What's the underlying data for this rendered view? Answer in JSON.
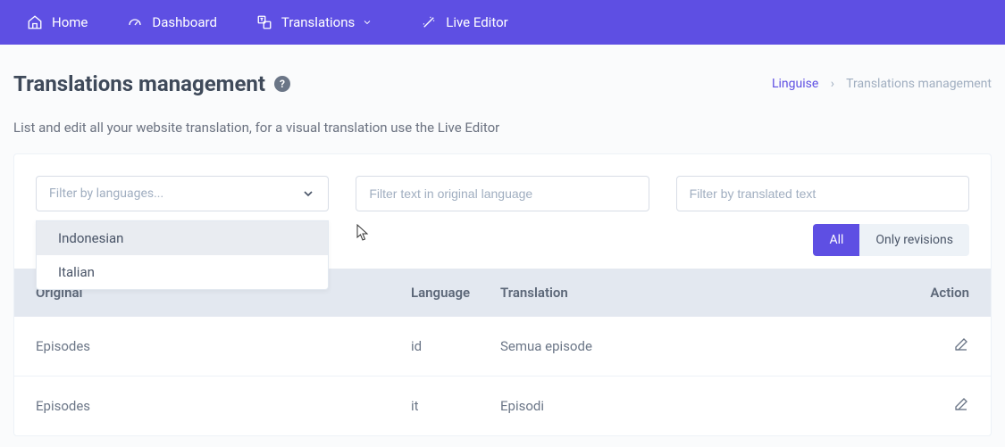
{
  "nav": {
    "home": "Home",
    "dashboard": "Dashboard",
    "translations": "Translations",
    "live_editor": "Live Editor"
  },
  "page": {
    "title": "Translations management",
    "subtitle": "List and edit all your website translation, for a visual translation use the Live Editor"
  },
  "breadcrumb": {
    "root": "Linguise",
    "current": "Translations management"
  },
  "filters": {
    "lang_placeholder": "Filter by languages...",
    "original_placeholder": "Filter text in original language",
    "translated_placeholder": "Filter by translated text",
    "dropdown": [
      "Indonesian",
      "Italian"
    ]
  },
  "toggle": {
    "all": "All",
    "revisions": "Only revisions"
  },
  "table": {
    "headers": {
      "original": "Original",
      "language": "Language",
      "translation": "Translation",
      "action": "Action"
    },
    "rows": [
      {
        "original": "Episodes",
        "language": "id",
        "translation": "Semua episode"
      },
      {
        "original": "Episodes",
        "language": "it",
        "translation": "Episodi"
      }
    ]
  }
}
